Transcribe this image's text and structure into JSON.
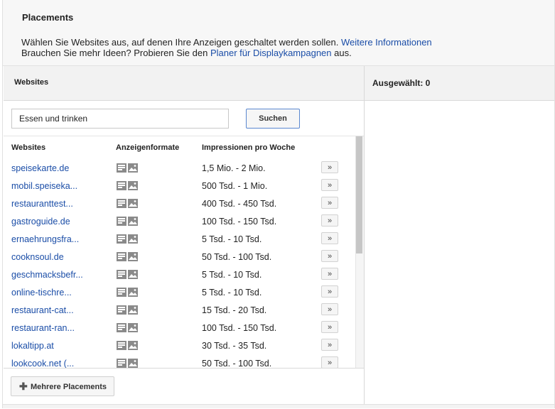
{
  "header": {
    "title": "Placements",
    "line1_text": "Wählen Sie Websites aus, auf denen Ihre Anzeigen geschaltet werden sollen.",
    "line1_link": "Weitere Informationen",
    "line2_text": "Brauchen Sie mehr Ideen? Probieren Sie den",
    "line2_link": "Planer für Displaykampagnen",
    "line2_suffix": "aus."
  },
  "left_panel": {
    "title": "Websites",
    "search": {
      "value": "Essen und trinken"
    },
    "search_button": "Suchen",
    "columns": {
      "site": "Websites",
      "formats": "Anzeigenformate",
      "impressions": "Impressionen pro Woche"
    },
    "rows": [
      {
        "site": "speisekarte.de",
        "impressions": "1,5 Mio. - 2 Mio.",
        "add": "»"
      },
      {
        "site": "mobil.speiseka...",
        "impressions": "500 Tsd. - 1 Mio.",
        "add": "»"
      },
      {
        "site": "restauranttest...",
        "impressions": "400 Tsd. - 450 Tsd.",
        "add": "»"
      },
      {
        "site": "gastroguide.de",
        "impressions": "100 Tsd. - 150 Tsd.",
        "add": "»"
      },
      {
        "site": "ernaehrungsfra...",
        "impressions": "5 Tsd. - 10 Tsd.",
        "add": "»"
      },
      {
        "site": "cooknsoul.de",
        "impressions": "50 Tsd. - 100 Tsd.",
        "add": "»"
      },
      {
        "site": "geschmacksbefr...",
        "impressions": "5 Tsd. - 10 Tsd.",
        "add": "»"
      },
      {
        "site": "online-tischre...",
        "impressions": "5 Tsd. - 10 Tsd.",
        "add": "»"
      },
      {
        "site": "restaurant-cat...",
        "impressions": "15 Tsd. - 20 Tsd.",
        "add": "»"
      },
      {
        "site": "restaurant-ran...",
        "impressions": "100 Tsd. - 150 Tsd.",
        "add": "»"
      },
      {
        "site": "lokaltipp.at",
        "impressions": "30 Tsd. - 35 Tsd.",
        "add": "»"
      },
      {
        "site": "lookcook.net (...",
        "impressions": "50 Tsd. - 100 Tsd.",
        "add": "»"
      }
    ],
    "footer_button": "Mehrere Placements"
  },
  "right_panel": {
    "title": "Ausgewählt: 0"
  },
  "colors": {
    "link": "#1a4da7",
    "panel_head_bg": "#f2f2f2",
    "icon_gray": "#8a8a8a",
    "button_border_active": "#5a87d0"
  },
  "icons": {
    "format_text": "text-ad-icon",
    "format_image": "image-ad-icon",
    "plus": "plus-icon",
    "add": "double-chevron-right-icon"
  }
}
